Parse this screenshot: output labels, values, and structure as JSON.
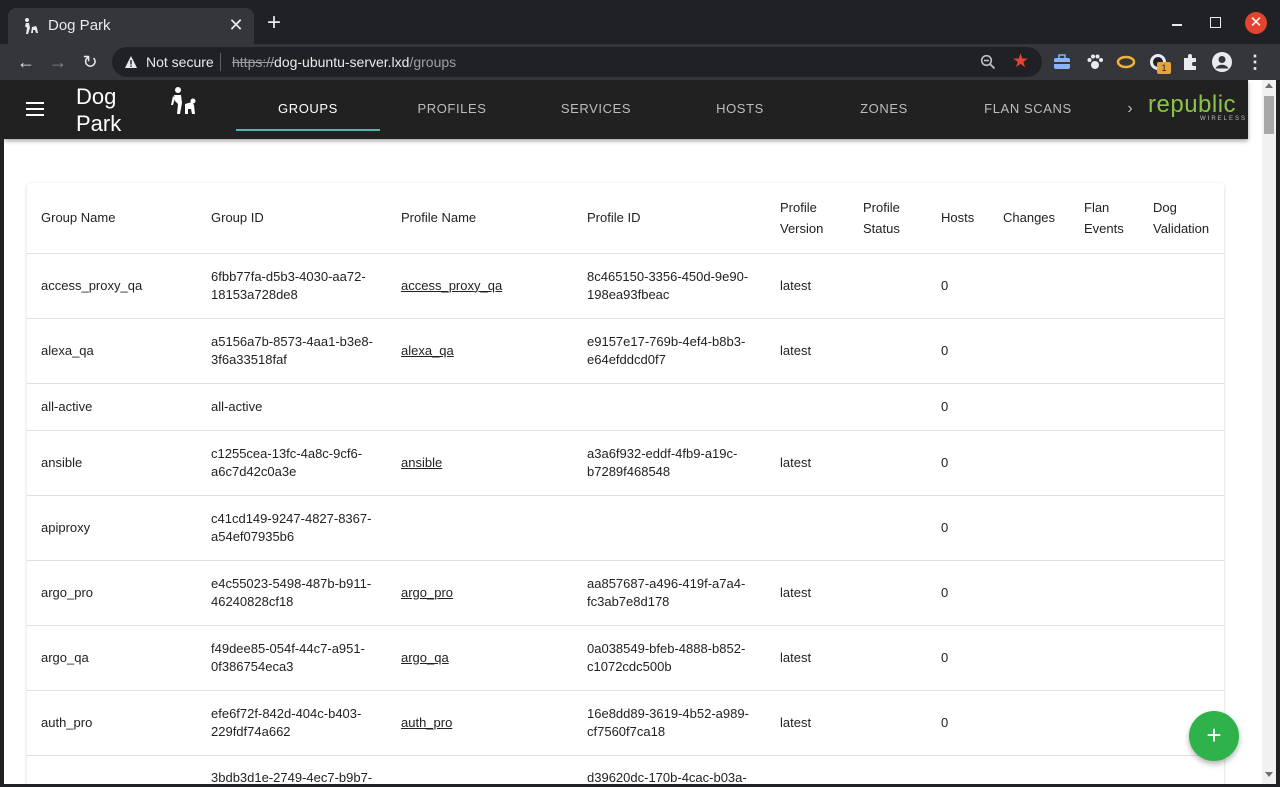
{
  "browser": {
    "tab_title": "Dog Park",
    "tab_close": "✕",
    "new_tab": "+",
    "close_window": "✕",
    "security_label": "Not secure",
    "url_scheme": "https://",
    "url_host": "dog-ubuntu-server.lxd",
    "url_path": "/groups",
    "ext_badge": "1"
  },
  "app": {
    "title": "Dog Park",
    "tabs": [
      {
        "label": "GROUPS"
      },
      {
        "label": "PROFILES"
      },
      {
        "label": "SERVICES"
      },
      {
        "label": "HOSTS"
      },
      {
        "label": "ZONES"
      },
      {
        "label": "FLAN SCANS"
      }
    ],
    "more": "›",
    "brand": "republic",
    "brand_sub": "WIRELESS",
    "fab": "+"
  },
  "table": {
    "headers": [
      "Group Name",
      "Group ID",
      "Profile Name",
      "Profile ID",
      "Profile Version",
      "Profile Status",
      "Hosts",
      "Changes",
      "Flan Events",
      "Dog Validation"
    ],
    "rows": [
      {
        "group_name": "access_proxy_qa",
        "group_id": "6fbb77fa-d5b3-4030-aa72-18153a728de8",
        "profile_name": "access_proxy_qa",
        "profile_id": "8c465150-3356-450d-9e90-198ea93fbeac",
        "profile_version": "latest",
        "hosts": "0"
      },
      {
        "group_name": "alexa_qa",
        "group_id": "a5156a7b-8573-4aa1-b3e8-3f6a33518faf",
        "profile_name": "alexa_qa",
        "profile_id": "e9157e17-769b-4ef4-b8b3-e64efddcd0f7",
        "profile_version": "latest",
        "hosts": "0"
      },
      {
        "group_name": "all-active",
        "group_id": "all-active",
        "profile_name": "",
        "profile_id": "",
        "profile_version": "",
        "hosts": "0"
      },
      {
        "group_name": "ansible",
        "group_id": "c1255cea-13fc-4a8c-9cf6-a6c7d42c0a3e",
        "profile_name": "ansible",
        "profile_id": "a3a6f932-eddf-4fb9-a19c-b7289f468548",
        "profile_version": "latest",
        "hosts": "0"
      },
      {
        "group_name": "apiproxy",
        "group_id": "c41cd149-9247-4827-8367-a54ef07935b6",
        "profile_name": "",
        "profile_id": "",
        "profile_version": "",
        "hosts": "0"
      },
      {
        "group_name": "argo_pro",
        "group_id": "e4c55023-5498-487b-b911-46240828cf18",
        "profile_name": "argo_pro",
        "profile_id": "aa857687-a496-419f-a7a4-fc3ab7e8d178",
        "profile_version": "latest",
        "hosts": "0"
      },
      {
        "group_name": "argo_qa",
        "group_id": "f49dee85-054f-44c7-a951-0f386754eca3",
        "profile_name": "argo_qa",
        "profile_id": "0a038549-bfeb-4888-b852-c1072cdc500b",
        "profile_version": "latest",
        "hosts": "0"
      },
      {
        "group_name": "auth_pro",
        "group_id": "efe6f72f-842d-404c-b403-229fdf74a662",
        "profile_name": "auth_pro",
        "profile_id": "16e8dd89-3619-4b52-a989-cf7560f7ca18",
        "profile_version": "latest",
        "hosts": "0"
      },
      {
        "group_name": "",
        "group_id": "3bdb3d1e-2749-4ec7-b9b7-",
        "profile_name": "",
        "profile_id": "d39620dc-170b-4cac-b03a-",
        "profile_version": "",
        "hosts": ""
      }
    ]
  },
  "colors": {
    "appbar": "#212121",
    "tab_indicator": "#4db6ac",
    "fab": "#2db34a",
    "brand": "#8bc34a",
    "close_window": "#e2442f"
  }
}
